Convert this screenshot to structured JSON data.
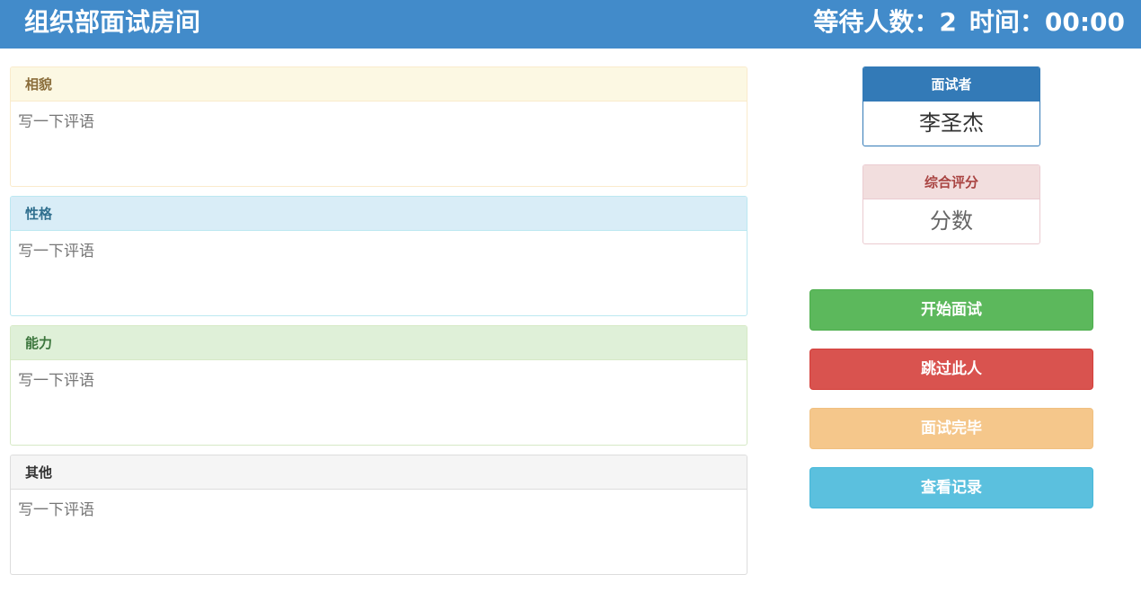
{
  "header": {
    "title": "组织部面试房间",
    "waiting_label": "等待人数：",
    "waiting_count": "2",
    "time_label": "时间：",
    "time_value": "00:00"
  },
  "panels": [
    {
      "title": "相貌",
      "placeholder": "写一下评语",
      "value": ""
    },
    {
      "title": "性格",
      "placeholder": "写一下评语",
      "value": ""
    },
    {
      "title": "能力",
      "placeholder": "写一下评语",
      "value": ""
    },
    {
      "title": "其他",
      "placeholder": "写一下评语",
      "value": ""
    }
  ],
  "interviewee": {
    "label": "面试者",
    "name": "李圣杰"
  },
  "score": {
    "label": "综合评分",
    "placeholder": "分数",
    "value": ""
  },
  "buttons": {
    "start": "开始面试",
    "skip": "跳过此人",
    "finish": "面试完毕",
    "records": "查看记录"
  },
  "colors": {
    "header": "#428bca",
    "start": "#5cb85c",
    "skip": "#d9534f",
    "finish": "#f5c78b",
    "records": "#5bc0de"
  }
}
